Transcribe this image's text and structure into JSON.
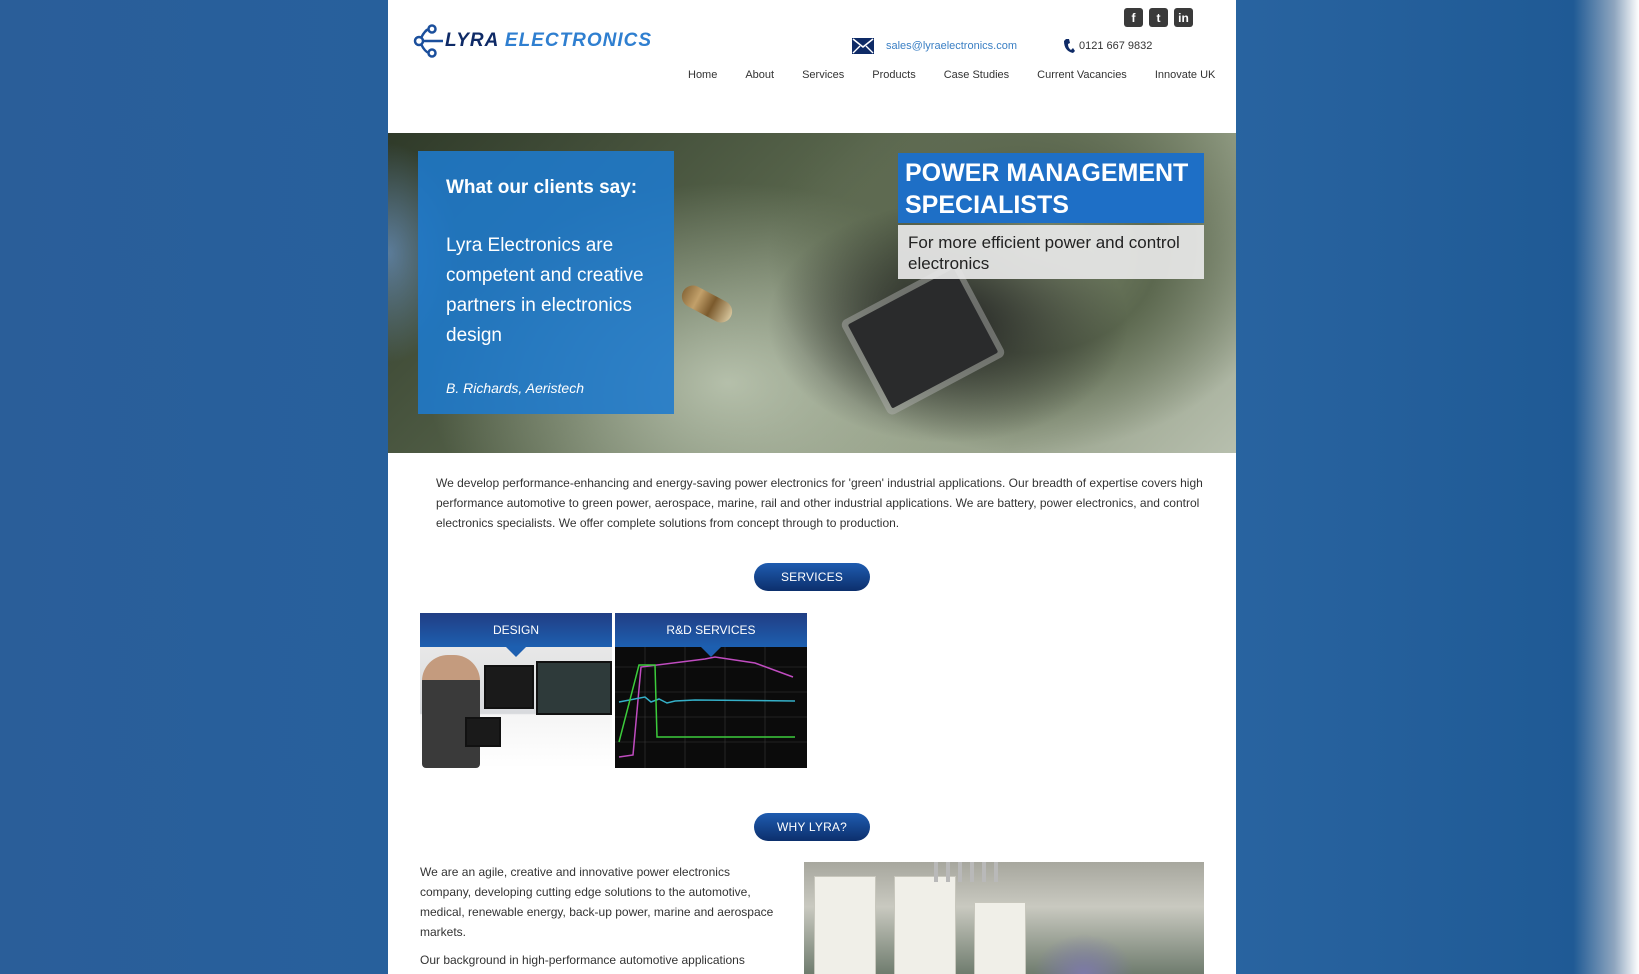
{
  "header": {
    "logo": {
      "word1": "LYRA",
      "word2": "ELECTRONICS"
    },
    "social": [
      {
        "name": "facebook",
        "glyph": "f"
      },
      {
        "name": "twitter",
        "glyph": "t"
      },
      {
        "name": "linkedin",
        "glyph": "in"
      }
    ],
    "email": "sales@lyraelectronics.com",
    "phone": "0121 667 9832"
  },
  "nav": {
    "items": [
      "Home",
      "About",
      "Services",
      "Products",
      "Case Studies",
      "Current Vacancies",
      "Innovate UK"
    ]
  },
  "hero": {
    "quote_title": "What our clients say:",
    "quote_text": "Lyra Electronics are competent and creative partners in electronics design",
    "quote_author": "B. Richards, Aeristech",
    "headline": "POWER MANAGEMENT SPECIALISTS",
    "subheadline": "For more efficient power and control electronics"
  },
  "intro": "We develop performance-enhancing and energy-saving power electronics for 'green' industrial applications. Our breadth of expertise covers high performance automotive to green power, aerospace, marine, rail and other industrial applications. We are battery, power electronics, and control electronics specialists. We offer complete solutions from concept through to production.",
  "services": {
    "heading": "SERVICES",
    "tiles": [
      {
        "label": "DESIGN"
      },
      {
        "label": "R&D SERVICES"
      }
    ]
  },
  "why": {
    "heading": "WHY LYRA?",
    "paragraphs": [
      "We are an agile, creative and innovative power electronics company, developing cutting edge solutions to the automotive, medical, renewable energy, back-up power, marine and aerospace markets.",
      "Our background in high-performance automotive applications"
    ]
  },
  "colors": {
    "background": "#25619f",
    "brand_blue": "#1e6fc6",
    "link": "#3a7fc4",
    "pill_dark": "#0c2f6c"
  }
}
